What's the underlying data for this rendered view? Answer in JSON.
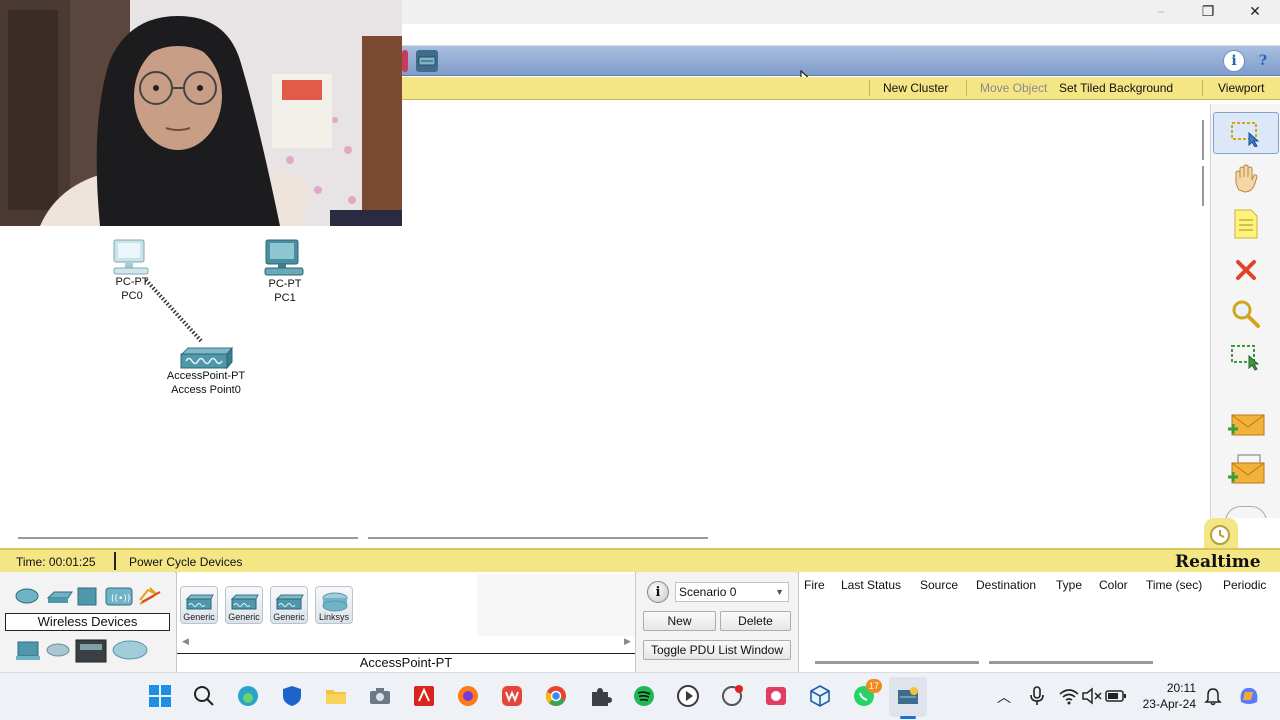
{
  "window": {
    "minimize": "–",
    "maximize": "❐",
    "close": "✕"
  },
  "logical_bar": {
    "new_cluster": "New Cluster",
    "move_object": "Move Object",
    "set_tiled_background": "Set Tiled Background",
    "viewport": "Viewport"
  },
  "topology": {
    "nodes": [
      {
        "model": "PC-PT",
        "name": "PC0"
      },
      {
        "model": "PC-PT",
        "name": "PC1"
      },
      {
        "model": "AccessPoint-PT",
        "name": "Access Point0"
      }
    ]
  },
  "status": {
    "time": "Time: 00:01:25",
    "power_cycle": "Power Cycle Devices",
    "mode": "Realtime"
  },
  "device_panel": {
    "category_label": "Wireless Devices",
    "selected_model": "AccessPoint-PT",
    "devices": [
      "Generic",
      "Generic",
      "Generic",
      "Linksys"
    ]
  },
  "scenario": {
    "info": "i",
    "selected": "Scenario 0",
    "new": "New",
    "delete": "Delete",
    "toggle_pdu": "Toggle PDU List Window"
  },
  "pdu_list": {
    "columns": [
      "Fire",
      "Last Status",
      "Source",
      "Destination",
      "Type",
      "Color",
      "Time (sec)",
      "Periodic"
    ]
  },
  "taskbar": {
    "whatsapp_badge": "17",
    "time": "20:11",
    "date": "23-Apr-24"
  },
  "colors": {
    "blue_toolbar": "#7f9cc9",
    "yellow_bar": "#f4e585",
    "delete_red": "#e0442a"
  }
}
